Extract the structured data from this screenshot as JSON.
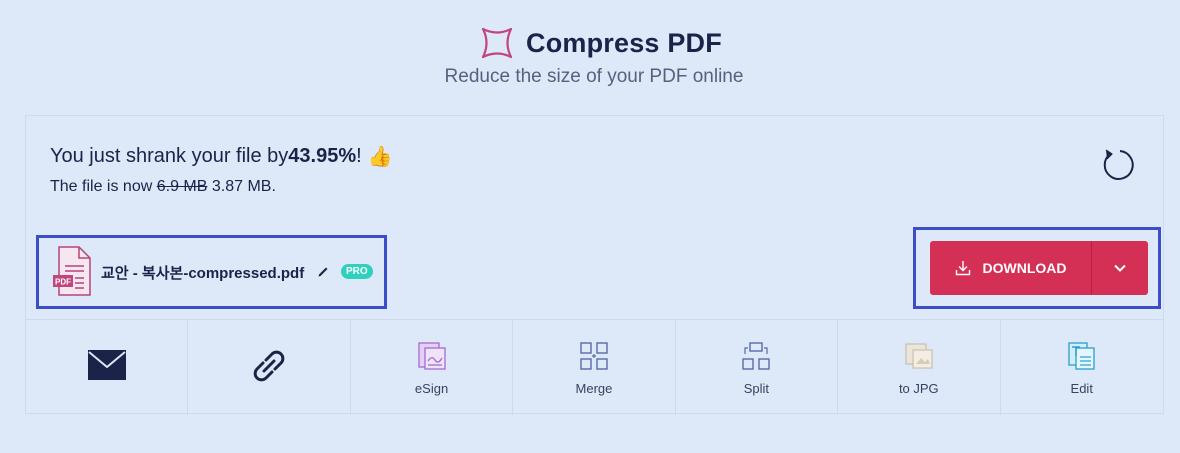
{
  "header": {
    "title": "Compress PDF",
    "subtitle": "Reduce the size of your PDF online"
  },
  "result": {
    "shrink_prefix": "You just shrank your file by ",
    "shrink_percent": "43.95%",
    "shrink_suffix": "!",
    "thumb_icon": "👍",
    "size_prefix": "The file is now ",
    "old_size": "6.9 MB",
    "new_size": "3.87 MB."
  },
  "file": {
    "name": "교안 - 복사본-compressed.pdf",
    "icon_label": "PDF",
    "badge": "PRO"
  },
  "download": {
    "label": "DOWNLOAD"
  },
  "tools": [
    {
      "label": "",
      "icon": "mail-icon"
    },
    {
      "label": "",
      "icon": "link-icon"
    },
    {
      "label": "eSign",
      "icon": "esign-icon"
    },
    {
      "label": "Merge",
      "icon": "merge-icon"
    },
    {
      "label": "Split",
      "icon": "split-icon"
    },
    {
      "label": "to JPG",
      "icon": "jpg-icon"
    },
    {
      "label": "Edit",
      "icon": "edit-icon"
    }
  ],
  "colors": {
    "background": "#dde8f9",
    "accent": "#d42f54",
    "highlight_border": "#3b4ec5",
    "pro_badge": "#2fd0bc"
  }
}
